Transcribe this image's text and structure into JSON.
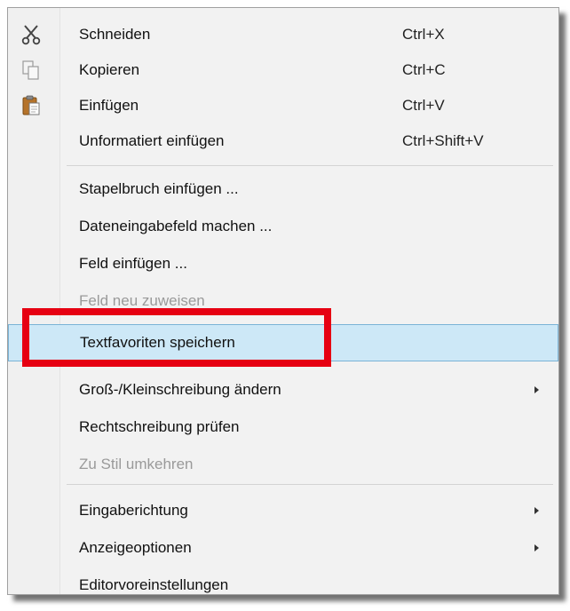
{
  "menu": {
    "items": [
      {
        "label": "Schneiden",
        "shortcut": "Ctrl+X",
        "icon": "scissors-icon"
      },
      {
        "label": "Kopieren",
        "shortcut": "Ctrl+C",
        "icon": "copy-icon"
      },
      {
        "label": "Einfügen",
        "shortcut": "Ctrl+V",
        "icon": "paste-icon"
      },
      {
        "label": "Unformatiert einfügen",
        "shortcut": "Ctrl+Shift+V"
      },
      {
        "label": "Stapelbruch einfügen ..."
      },
      {
        "label": "Dateneingabefeld machen ..."
      },
      {
        "label": "Feld einfügen ..."
      },
      {
        "label": "Feld neu zuweisen",
        "state": "disabled"
      },
      {
        "label": "Textfavoriten speichern",
        "state": "highlighted"
      },
      {
        "label": "Groß-/Kleinschreibung ändern",
        "submenu": true
      },
      {
        "label": "Rechtschreibung prüfen"
      },
      {
        "label": "Zu Stil umkehren",
        "state": "disabled"
      },
      {
        "label": "Eingaberichtung",
        "submenu": true
      },
      {
        "label": "Anzeigeoptionen",
        "submenu": true
      },
      {
        "label": "Editorvoreinstellungen"
      }
    ]
  },
  "colors": {
    "highlight_background": "#cde8f7",
    "highlight_border": "#7ab3d6",
    "annotation_box": "#e60012",
    "disabled_text": "#9a9a9a"
  }
}
